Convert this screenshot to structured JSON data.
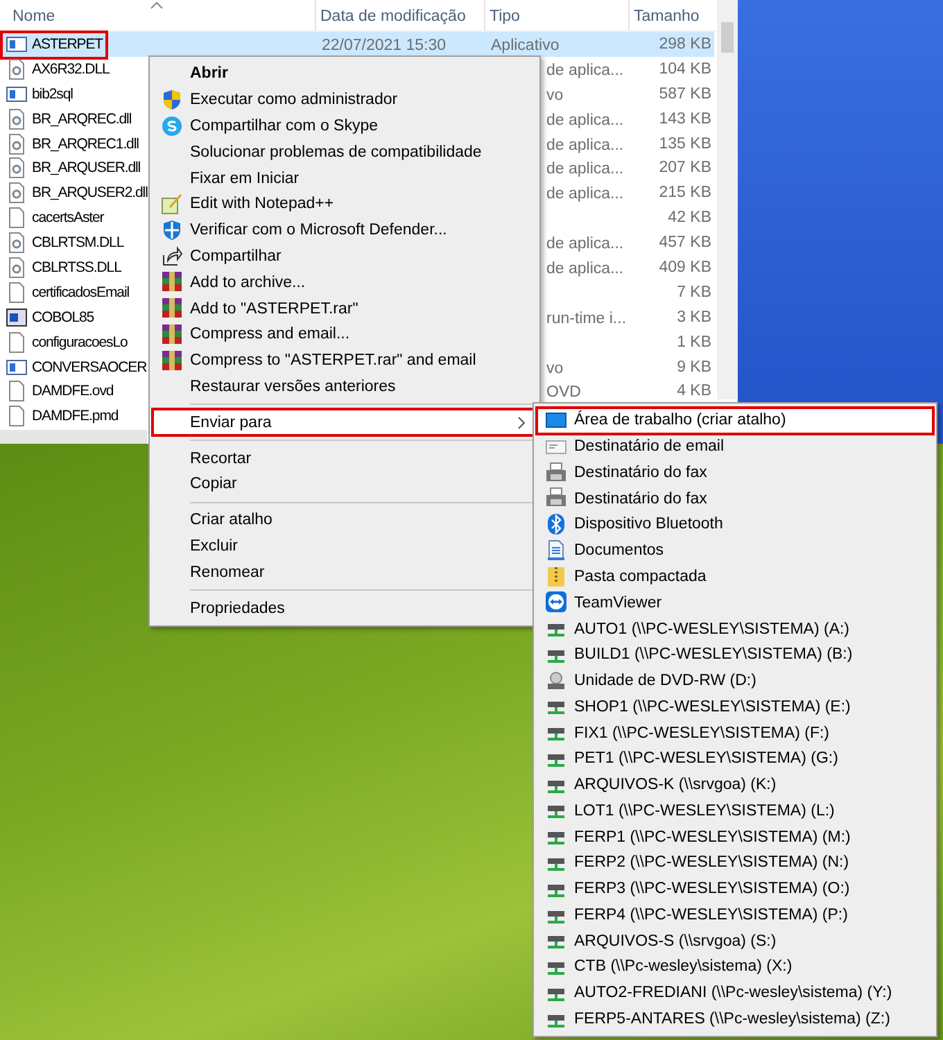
{
  "explorer": {
    "columns": [
      "Nome",
      "Data de modificação",
      "Tipo",
      "Tamanho"
    ],
    "rows": [
      {
        "name": "ASTERPET",
        "kind": "app",
        "date": "22/07/2021 15:30",
        "type": "Aplicativo",
        "size": "298 KB",
        "selected": true,
        "highlighted": true
      },
      {
        "name": "AX6R32.DLL",
        "kind": "dll",
        "type": "de aplica...",
        "size": "104 KB",
        "selected": false,
        "highlighted": false
      },
      {
        "name": "bib2sql",
        "kind": "app",
        "type": "vo",
        "size": "587 KB",
        "selected": false,
        "highlighted": false
      },
      {
        "name": "BR_ARQREC.dll",
        "kind": "dll",
        "type": "de aplica...",
        "size": "143 KB",
        "selected": false,
        "highlighted": false
      },
      {
        "name": "BR_ARQREC1.dll",
        "kind": "dll",
        "type": "de aplica...",
        "size": "135 KB",
        "selected": false,
        "highlighted": false
      },
      {
        "name": "BR_ARQUSER.dll",
        "kind": "dll",
        "type": "de aplica...",
        "size": "207 KB",
        "selected": false,
        "highlighted": false
      },
      {
        "name": "BR_ARQUSER2.dll",
        "kind": "dll",
        "type": "de aplica...",
        "size": "215 KB",
        "selected": false,
        "highlighted": false
      },
      {
        "name": "cacertsAster",
        "kind": "file",
        "size": "42 KB",
        "selected": false,
        "highlighted": false
      },
      {
        "name": "CBLRTSM.DLL",
        "kind": "dll",
        "type": "de aplica...",
        "size": "457 KB",
        "selected": false,
        "highlighted": false
      },
      {
        "name": "CBLRTSS.DLL",
        "kind": "dll",
        "type": "de aplica...",
        "size": "409 KB",
        "selected": false,
        "highlighted": false
      },
      {
        "name": "certificadosEmail",
        "kind": "file",
        "size": "7 KB",
        "selected": false,
        "highlighted": false
      },
      {
        "name": "COBOL85",
        "kind": "exe",
        "type": "run-time i...",
        "size": "3 KB",
        "selected": false,
        "highlighted": false
      },
      {
        "name": "configuracoesLo",
        "kind": "file",
        "size": "1 KB",
        "selected": false,
        "highlighted": false
      },
      {
        "name": "CONVERSAOCER",
        "kind": "app",
        "type": "vo",
        "size": "9 KB",
        "selected": false,
        "highlighted": false
      },
      {
        "name": "DAMDFE.ovd",
        "kind": "file",
        "type": "OVD",
        "size": "4 KB",
        "selected": false,
        "highlighted": false
      },
      {
        "name": "DAMDFE.pmd",
        "kind": "file",
        "selected": false,
        "highlighted": false
      }
    ]
  },
  "context_menu": {
    "items": [
      {
        "kind": "plain",
        "label": "Abrir",
        "default": true
      },
      {
        "kind": "shield",
        "label": "Executar como administrador"
      },
      {
        "kind": "skype",
        "label": "Compartilhar com o Skype"
      },
      {
        "kind": "plain",
        "label": "Solucionar problemas de compatibilidade"
      },
      {
        "kind": "plain",
        "label": "Fixar em Iniciar"
      },
      {
        "kind": "notepad",
        "label": "Edit with Notepad++"
      },
      {
        "kind": "defender",
        "label": "Verificar com o Microsoft Defender..."
      },
      {
        "kind": "share",
        "label": "Compartilhar"
      },
      {
        "kind": "archive",
        "label": "Add to archive..."
      },
      {
        "kind": "archive",
        "label": "Add to \"ASTERPET.rar\""
      },
      {
        "kind": "archive",
        "label": "Compress and email..."
      },
      {
        "kind": "archive",
        "label": "Compress to \"ASTERPET.rar\" and email"
      },
      {
        "kind": "plain",
        "label": "Restaurar versões anteriores"
      },
      {
        "kind": "separator"
      },
      {
        "kind": "submenu",
        "label": "Enviar para",
        "highlighted": true
      },
      {
        "kind": "separator"
      },
      {
        "kind": "plain",
        "label": "Recortar"
      },
      {
        "kind": "plain",
        "label": "Copiar"
      },
      {
        "kind": "separator"
      },
      {
        "kind": "plain",
        "label": "Criar atalho"
      },
      {
        "kind": "plain",
        "label": "Excluir"
      },
      {
        "kind": "plain",
        "label": "Renomear"
      },
      {
        "kind": "separator"
      },
      {
        "kind": "plain",
        "label": "Propriedades"
      }
    ]
  },
  "send_to_menu": {
    "items": [
      {
        "label": "Área de trabalho (criar atalho)",
        "kind": "desktop",
        "highlighted": true
      },
      {
        "label": "Destinatário de email",
        "kind": "mail",
        "highlighted": false
      },
      {
        "label": "Destinatário do fax",
        "kind": "fax",
        "highlighted": false
      },
      {
        "label": "Destinatário do fax",
        "kind": "fax",
        "highlighted": false
      },
      {
        "label": "Dispositivo Bluetooth",
        "kind": "bluetooth",
        "highlighted": false
      },
      {
        "label": "Documentos",
        "kind": "documents",
        "highlighted": false
      },
      {
        "label": "Pasta compactada",
        "kind": "zip",
        "highlighted": false
      },
      {
        "label": "TeamViewer",
        "kind": "teamviewer",
        "highlighted": false
      },
      {
        "label": "AUTO1 (\\\\PC-WESLEY\\SISTEMA) (A:)",
        "kind": "drive",
        "highlighted": false
      },
      {
        "label": "BUILD1 (\\\\PC-WESLEY\\SISTEMA) (B:)",
        "kind": "drive",
        "highlighted": false
      },
      {
        "label": "Unidade de DVD-RW (D:)",
        "kind": "dvd",
        "highlighted": false
      },
      {
        "label": "SHOP1 (\\\\PC-WESLEY\\SISTEMA) (E:)",
        "kind": "drive",
        "highlighted": false
      },
      {
        "label": "FIX1 (\\\\PC-WESLEY\\SISTEMA) (F:)",
        "kind": "drive",
        "highlighted": false
      },
      {
        "label": "PET1 (\\\\PC-WESLEY\\SISTEMA) (G:)",
        "kind": "drive",
        "highlighted": false
      },
      {
        "label": "ARQUIVOS-K (\\\\srvgoa) (K:)",
        "kind": "drive",
        "highlighted": false
      },
      {
        "label": "LOT1 (\\\\PC-WESLEY\\SISTEMA) (L:)",
        "kind": "drive",
        "highlighted": false
      },
      {
        "label": "FERP1 (\\\\PC-WESLEY\\SISTEMA) (M:)",
        "kind": "drive",
        "highlighted": false
      },
      {
        "label": "FERP2 (\\\\PC-WESLEY\\SISTEMA) (N:)",
        "kind": "drive",
        "highlighted": false
      },
      {
        "label": "FERP3 (\\\\PC-WESLEY\\SISTEMA) (O:)",
        "kind": "drive",
        "highlighted": false
      },
      {
        "label": "FERP4 (\\\\PC-WESLEY\\SISTEMA) (P:)",
        "kind": "drive",
        "highlighted": false
      },
      {
        "label": "ARQUIVOS-S (\\\\srvgoa) (S:)",
        "kind": "drive",
        "highlighted": false
      },
      {
        "label": "CTB (\\\\Pc-wesley\\sistema) (X:)",
        "kind": "drive",
        "highlighted": false
      },
      {
        "label": "AUTO2-FREDIANI (\\\\Pc-wesley\\sistema) (Y:)",
        "kind": "drive",
        "highlighted": false
      },
      {
        "label": "FERP5-ANTARES (\\\\Pc-wesley\\sistema) (Z:)",
        "kind": "drive",
        "highlighted": false
      }
    ]
  }
}
